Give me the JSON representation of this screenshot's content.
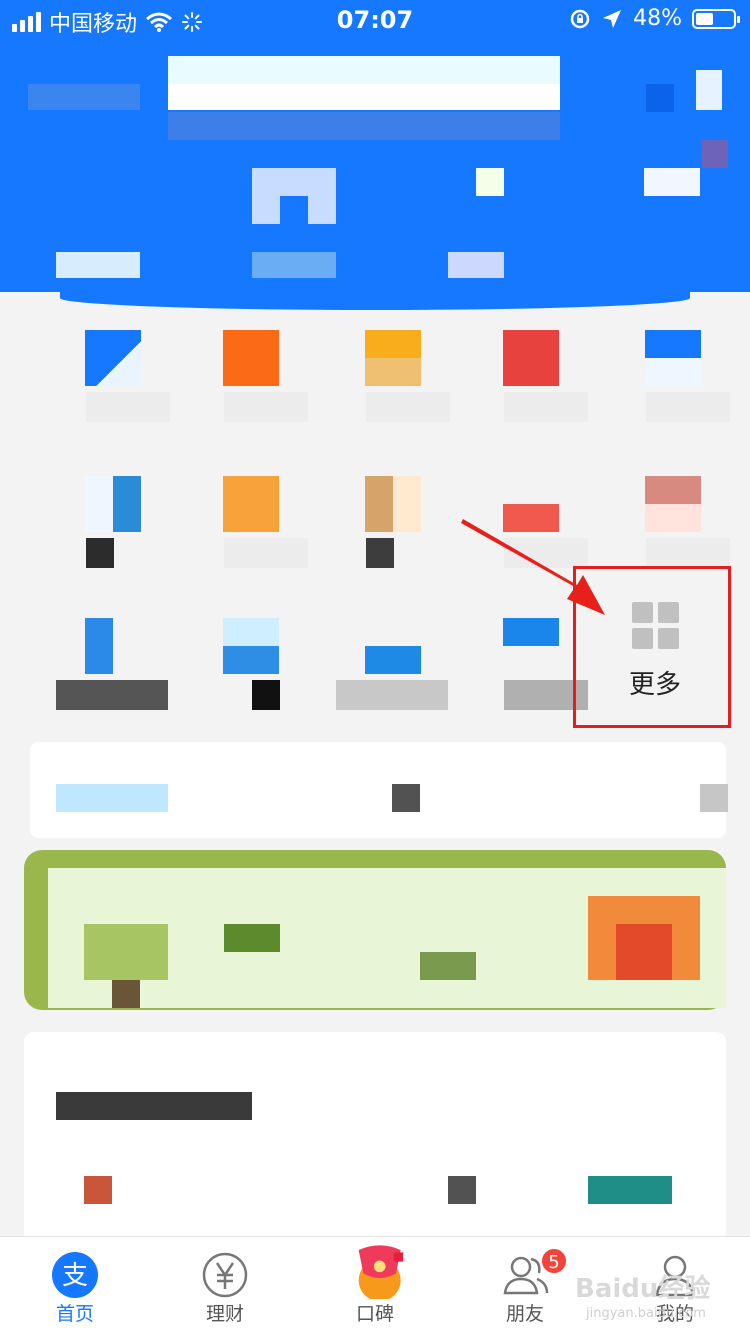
{
  "status_bar": {
    "carrier": "中国移动",
    "time": "07:07",
    "battery": "48%",
    "battery_level": 0.48
  },
  "icons": {
    "wifi": "wifi-icon",
    "loading": "loading-spinner-icon",
    "orientation_lock": "orientation-lock-icon",
    "location": "location-arrow-icon",
    "more": "grid-icon"
  },
  "grid": {
    "more_label": "更多"
  },
  "tabbar": {
    "items": [
      {
        "label": "首页",
        "icon": "alipay-icon",
        "active": true
      },
      {
        "label": "理财",
        "icon": "yen-coin-icon",
        "active": false
      },
      {
        "label": "口碑",
        "icon": "koubei-icon",
        "active": false
      },
      {
        "label": "朋友",
        "icon": "friends-icon",
        "active": false,
        "badge": "5"
      },
      {
        "label": "我的",
        "icon": "profile-icon",
        "active": false
      }
    ]
  },
  "watermark": {
    "text": "Baidu经验",
    "sub": "jingyan.baidu.com"
  },
  "colors": {
    "brand_blue": "#1677ff",
    "highlight_red": "#e02020",
    "badge_red": "#f5433a"
  }
}
